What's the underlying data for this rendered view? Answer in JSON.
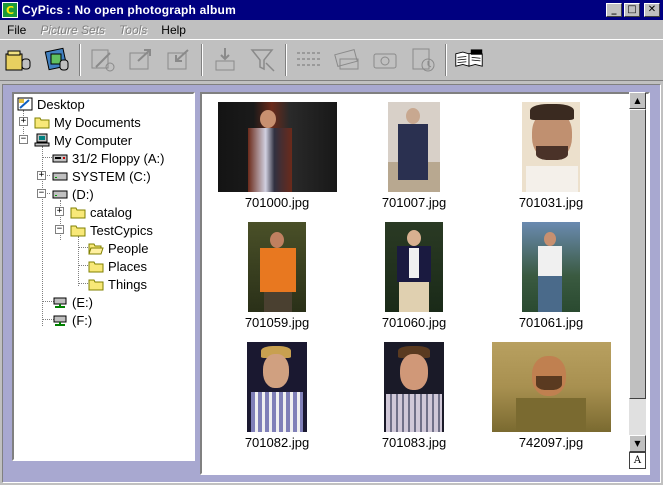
{
  "window": {
    "title": "CyPics : No open photograph album",
    "app_icon": "C",
    "minimize_glyph": "_",
    "maximize_glyph": "□",
    "close_glyph": "✕"
  },
  "menu": {
    "items": [
      {
        "label": "File",
        "enabled": true
      },
      {
        "label": "Picture Sets",
        "enabled": false
      },
      {
        "label": "Tools",
        "enabled": false
      },
      {
        "label": "Help",
        "enabled": true
      }
    ]
  },
  "toolbar": {
    "buttons": [
      {
        "icon": "open-album-icon",
        "enabled": true
      },
      {
        "icon": "new-album-icon",
        "enabled": true
      },
      {
        "icon": "edit-picture-icon",
        "enabled": false
      },
      {
        "icon": "export-picture-icon",
        "enabled": false
      },
      {
        "icon": "import-picture-icon",
        "enabled": false
      },
      {
        "icon": "import-down-icon",
        "enabled": false
      },
      {
        "icon": "filter-icon",
        "enabled": false
      },
      {
        "icon": "arrange-icon",
        "enabled": false
      },
      {
        "icon": "slide-icon",
        "enabled": false
      },
      {
        "icon": "camera-icon",
        "enabled": false
      },
      {
        "icon": "scan-icon",
        "enabled": false
      },
      {
        "icon": "whats-this-help-icon",
        "enabled": true
      }
    ]
  },
  "tree": {
    "items": [
      {
        "label": "Desktop",
        "icon": "desktop-icon"
      },
      {
        "label": "My Documents",
        "icon": "folder-icon",
        "expander": "+"
      },
      {
        "label": "My Computer",
        "icon": "computer-icon",
        "expander": "−"
      },
      {
        "label": "31/2 Floppy (A:)",
        "icon": "floppy-drive-icon"
      },
      {
        "label": "SYSTEM (C:)",
        "icon": "hard-drive-icon",
        "expander": "+"
      },
      {
        "label": "(D:)",
        "icon": "hard-drive-icon",
        "expander": "−"
      },
      {
        "label": "catalog",
        "icon": "folder-icon",
        "expander": "+"
      },
      {
        "label": "TestCypics",
        "icon": "folder-icon",
        "expander": "−"
      },
      {
        "label": "People",
        "icon": "folder-icon"
      },
      {
        "label": "Places",
        "icon": "folder-icon"
      },
      {
        "label": "Things",
        "icon": "folder-icon"
      },
      {
        "label": "(E:)",
        "icon": "network-drive-icon"
      },
      {
        "label": "(F:)",
        "icon": "network-drive-icon"
      }
    ]
  },
  "thumbnails": [
    {
      "filename": "701000.jpg",
      "colors": [
        "#1a1a1a",
        "#6b2a1a",
        "#c89070"
      ]
    },
    {
      "filename": "701007.jpg",
      "colors": [
        "#d8d0c8",
        "#2a3050",
        "#b8a890"
      ]
    },
    {
      "filename": "701031.jpg",
      "colors": [
        "#e8d8c0",
        "#3a2a20",
        "#c09070"
      ]
    },
    {
      "filename": "701059.jpg",
      "colors": [
        "#2a3018",
        "#e87820",
        "#c08060"
      ]
    },
    {
      "filename": "701060.jpg",
      "colors": [
        "#1a2a18",
        "#1a1a40",
        "#e0d0b0"
      ]
    },
    {
      "filename": "701061.jpg",
      "colors": [
        "#3a5a40",
        "#f0f0f0",
        "#4a6a8a"
      ]
    },
    {
      "filename": "701082.jpg",
      "colors": [
        "#1a1830",
        "#8080b8",
        "#d0a080"
      ]
    },
    {
      "filename": "701083.jpg",
      "colors": [
        "#1a1a28",
        "#d0c8d8",
        "#d09878"
      ]
    },
    {
      "filename": "742097.jpg",
      "colors": [
        "#a89050",
        "#7a6a30",
        "#c08050"
      ]
    }
  ],
  "scrollbar": {
    "up_glyph": "▲",
    "down_glyph": "▼"
  },
  "size_box_label": "A"
}
